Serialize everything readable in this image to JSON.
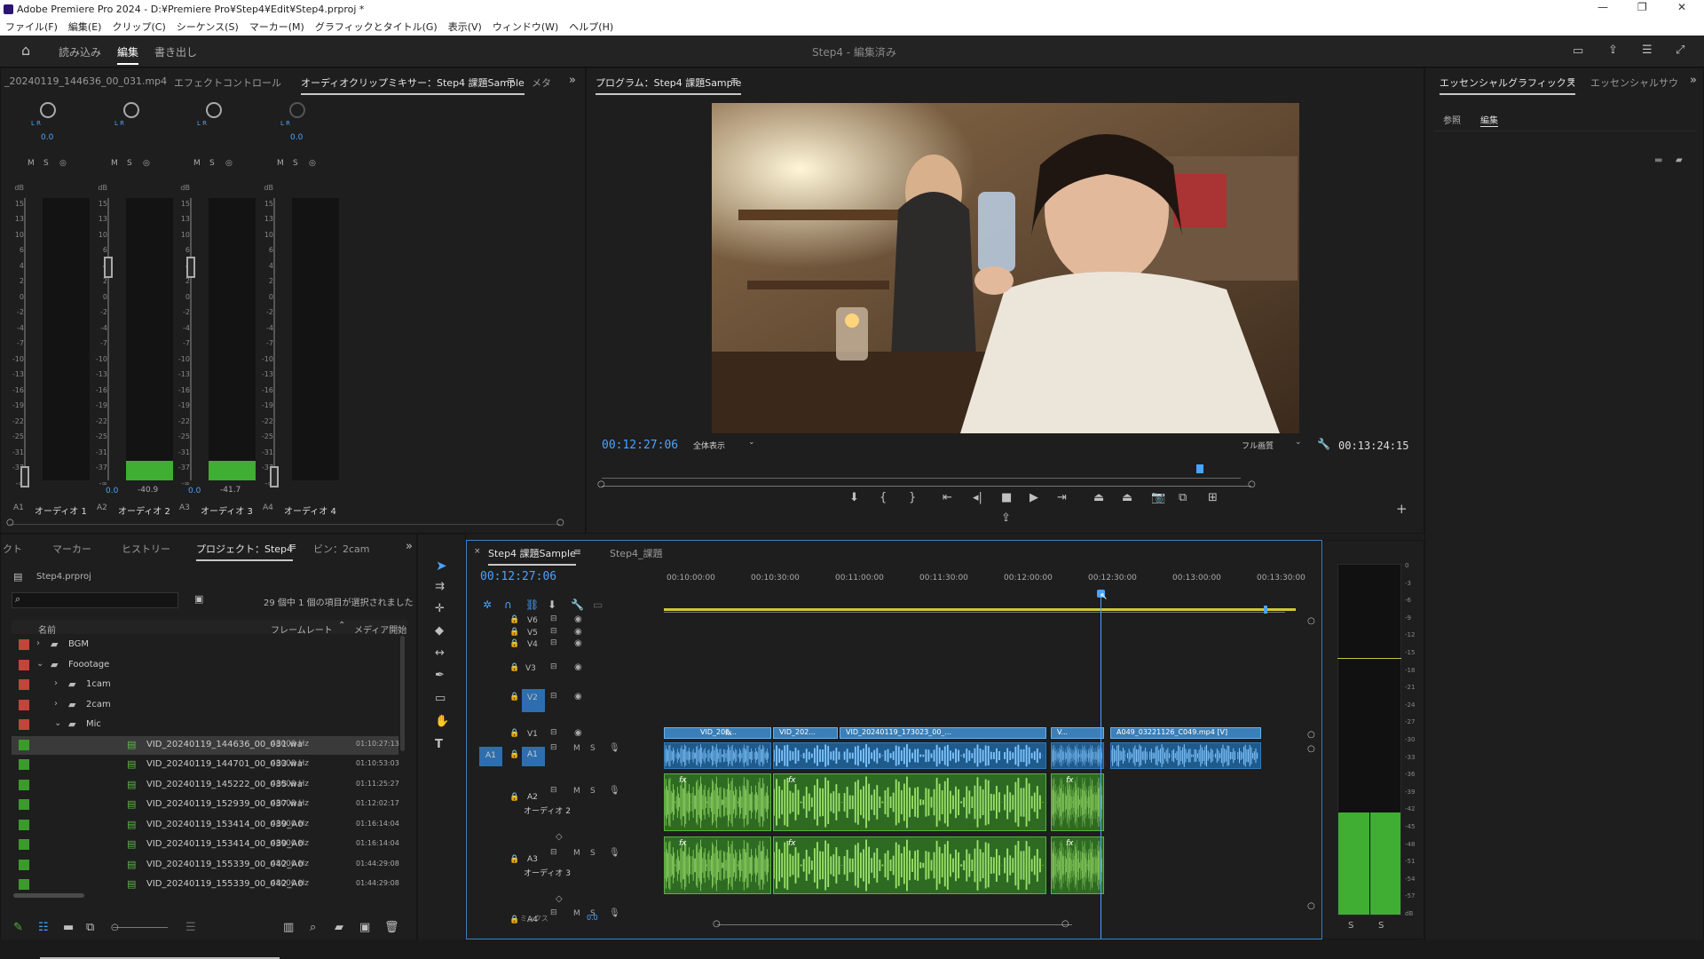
{
  "window": {
    "title": "Adobe Premiere Pro 2024 - D:¥Premiere Pro¥Step4¥Edit¥Step4.prproj *"
  },
  "menu": [
    "ファイル(F)",
    "編集(E)",
    "クリップ(C)",
    "シーケンス(S)",
    "マーカー(M)",
    "グラフィックとタイトル(G)",
    "表示(V)",
    "ウィンドウ(W)",
    "ヘルプ(H)"
  ],
  "workspace": {
    "tabs": [
      "読み込み",
      "編集",
      "書き出し"
    ],
    "active": "編集",
    "center": "Step4 - 編集済み"
  },
  "source_panel": {
    "tabs": [
      "_20240119_144636_00_031.mp4",
      "エフェクトコントロール",
      "オーディオクリップミキサー：Step4 課題Sample",
      "メタ"
    ],
    "active": "オーディオクリップミキサー：Step4 課題Sample",
    "channels": [
      {
        "label": "A1",
        "name": "オーディオ 1",
        "pan": "0.0",
        "value": "",
        "level": 0
      },
      {
        "label": "A2",
        "name": "オーディオ 2",
        "pan": "",
        "value": "-40.9",
        "vol": "0.0",
        "level": 0.07
      },
      {
        "label": "A3",
        "name": "オーディオ 3",
        "pan": "",
        "value": "-41.7",
        "vol": "0.0",
        "level": 0.07
      },
      {
        "label": "A4",
        "name": "オーディオ 4",
        "pan": "0.0",
        "value": "",
        "level": 0
      }
    ],
    "db_scale": [
      "dB",
      "15",
      "13",
      "10",
      "6",
      "4",
      "2",
      "0",
      "-2",
      "-4",
      "-7",
      "-10",
      "-13",
      "-16",
      "-19",
      "-22",
      "-25",
      "-31",
      "-37",
      "-∞"
    ],
    "ms_labels": [
      "M",
      "S",
      "◎"
    ]
  },
  "program_panel": {
    "title": "プログラム：Step4 課題Sample",
    "timecode": "00:12:27:06",
    "duration": "00:13:24:15",
    "zoom": "全体表示",
    "quality": "フル画質",
    "playhead_fraction": 0.93
  },
  "essential_graphics": {
    "tabs": [
      "エッセンシャルグラフィックス",
      "エッセンシャルサウ"
    ],
    "subtabs": [
      "参照",
      "編集"
    ],
    "active_subtab": "編集"
  },
  "project_panel": {
    "tabs": [
      "クト",
      "マーカー",
      "ヒストリー",
      "プロジェクト：Step4",
      "ビン：2cam"
    ],
    "active": "プロジェクト：Step4",
    "file": "Step4.prproj",
    "selection": "29 個中 1 個の項目が選択されました",
    "columns": [
      "名前",
      "フレームレート",
      "メディア開始"
    ],
    "items": [
      {
        "name": "BGM",
        "indent": 1,
        "type": "folder",
        "expand": "›",
        "color": "#c0453a",
        "rate": "",
        "start": ""
      },
      {
        "name": "Foootage",
        "indent": 1,
        "type": "folder",
        "expand": "⌄",
        "color": "#c0453a",
        "rate": "",
        "start": ""
      },
      {
        "name": "1cam",
        "indent": 2,
        "type": "folder",
        "expand": "›",
        "color": "#c0453a",
        "rate": "",
        "start": ""
      },
      {
        "name": "2cam",
        "indent": 2,
        "type": "folder",
        "expand": "›",
        "color": "#c0453a",
        "rate": "",
        "start": ""
      },
      {
        "name": "Mic",
        "indent": 2,
        "type": "folder",
        "expand": "⌄",
        "color": "#c0453a",
        "rate": "",
        "start": ""
      },
      {
        "name": "VID_20240119_144636_00_031.wa",
        "indent": 3,
        "type": "audio",
        "color": "#3c9a2d",
        "rate": "48000 Hz",
        "start": "01:10:27:13",
        "selected": true
      },
      {
        "name": "VID_20240119_144701_00_033.wa",
        "indent": 3,
        "type": "audio",
        "color": "#3c9a2d",
        "rate": "48000 Hz",
        "start": "01:10:53:03"
      },
      {
        "name": "VID_20240119_145222_00_035.wa",
        "indent": 3,
        "type": "audio",
        "color": "#3c9a2d",
        "rate": "48000 Hz",
        "start": "01:11:25:27"
      },
      {
        "name": "VID_20240119_152939_00_037.wa",
        "indent": 3,
        "type": "audio",
        "color": "#3c9a2d",
        "rate": "48000 Hz",
        "start": "01:12:02:17"
      },
      {
        "name": "VID_20240119_153414_00_039_A0",
        "indent": 3,
        "type": "audio",
        "color": "#3c9a2d",
        "rate": "48000 Hz",
        "start": "01:16:14:04"
      },
      {
        "name": "VID_20240119_153414_00_039_A0",
        "indent": 3,
        "type": "audio",
        "color": "#3c9a2d",
        "rate": "48000 Hz",
        "start": "01:16:14:04"
      },
      {
        "name": "VID_20240119_155339_00_042_A0",
        "indent": 3,
        "type": "audio",
        "color": "#3c9a2d",
        "rate": "48000 Hz",
        "start": "01:44:29:08"
      },
      {
        "name": "VID_20240119_155339_00_042_A0",
        "indent": 3,
        "type": "audio",
        "color": "#3c9a2d",
        "rate": "48000 Hz",
        "start": "01:44:29:08"
      }
    ]
  },
  "timeline": {
    "tabs": [
      "Step4 課題Sample",
      "Step4_課題"
    ],
    "active": "Step4 課題Sample",
    "timecode": "00:12:27:06",
    "ruler": [
      "00:10:00:00",
      "00:10:30:00",
      "00:11:00:00",
      "00:11:30:00",
      "00:12:00:00",
      "00:12:30:00",
      "00:13:00:00",
      "00:13:30:00"
    ],
    "video_tracks": [
      "V6",
      "V5",
      "V4",
      "V3",
      "V2",
      "V1"
    ],
    "audio_tracks": [
      "A1",
      "A2",
      "A3",
      "A4"
    ],
    "a2_name": "オーディオ 2",
    "a3_name": "オーディオ 3",
    "mix_label": "ミックス",
    "mix_value": "0.0",
    "clips_v1": [
      "VID_202...",
      "VID_202...",
      "VID_20240119_173023_00_...",
      "V...",
      "A049_03221126_C049.mp4 [V]"
    ],
    "fx": "fx",
    "ms": [
      "M",
      "S"
    ]
  },
  "audio_meter": {
    "scale": [
      "0",
      "-3",
      "-6",
      "-9",
      "-12",
      "-15",
      "-18",
      "-21",
      "-24",
      "-27",
      "-30",
      "-33",
      "-36",
      "-39",
      "-42",
      "-45",
      "-48",
      "-51",
      "-54",
      "-57",
      "dB"
    ],
    "solo": [
      "S",
      "S"
    ]
  }
}
